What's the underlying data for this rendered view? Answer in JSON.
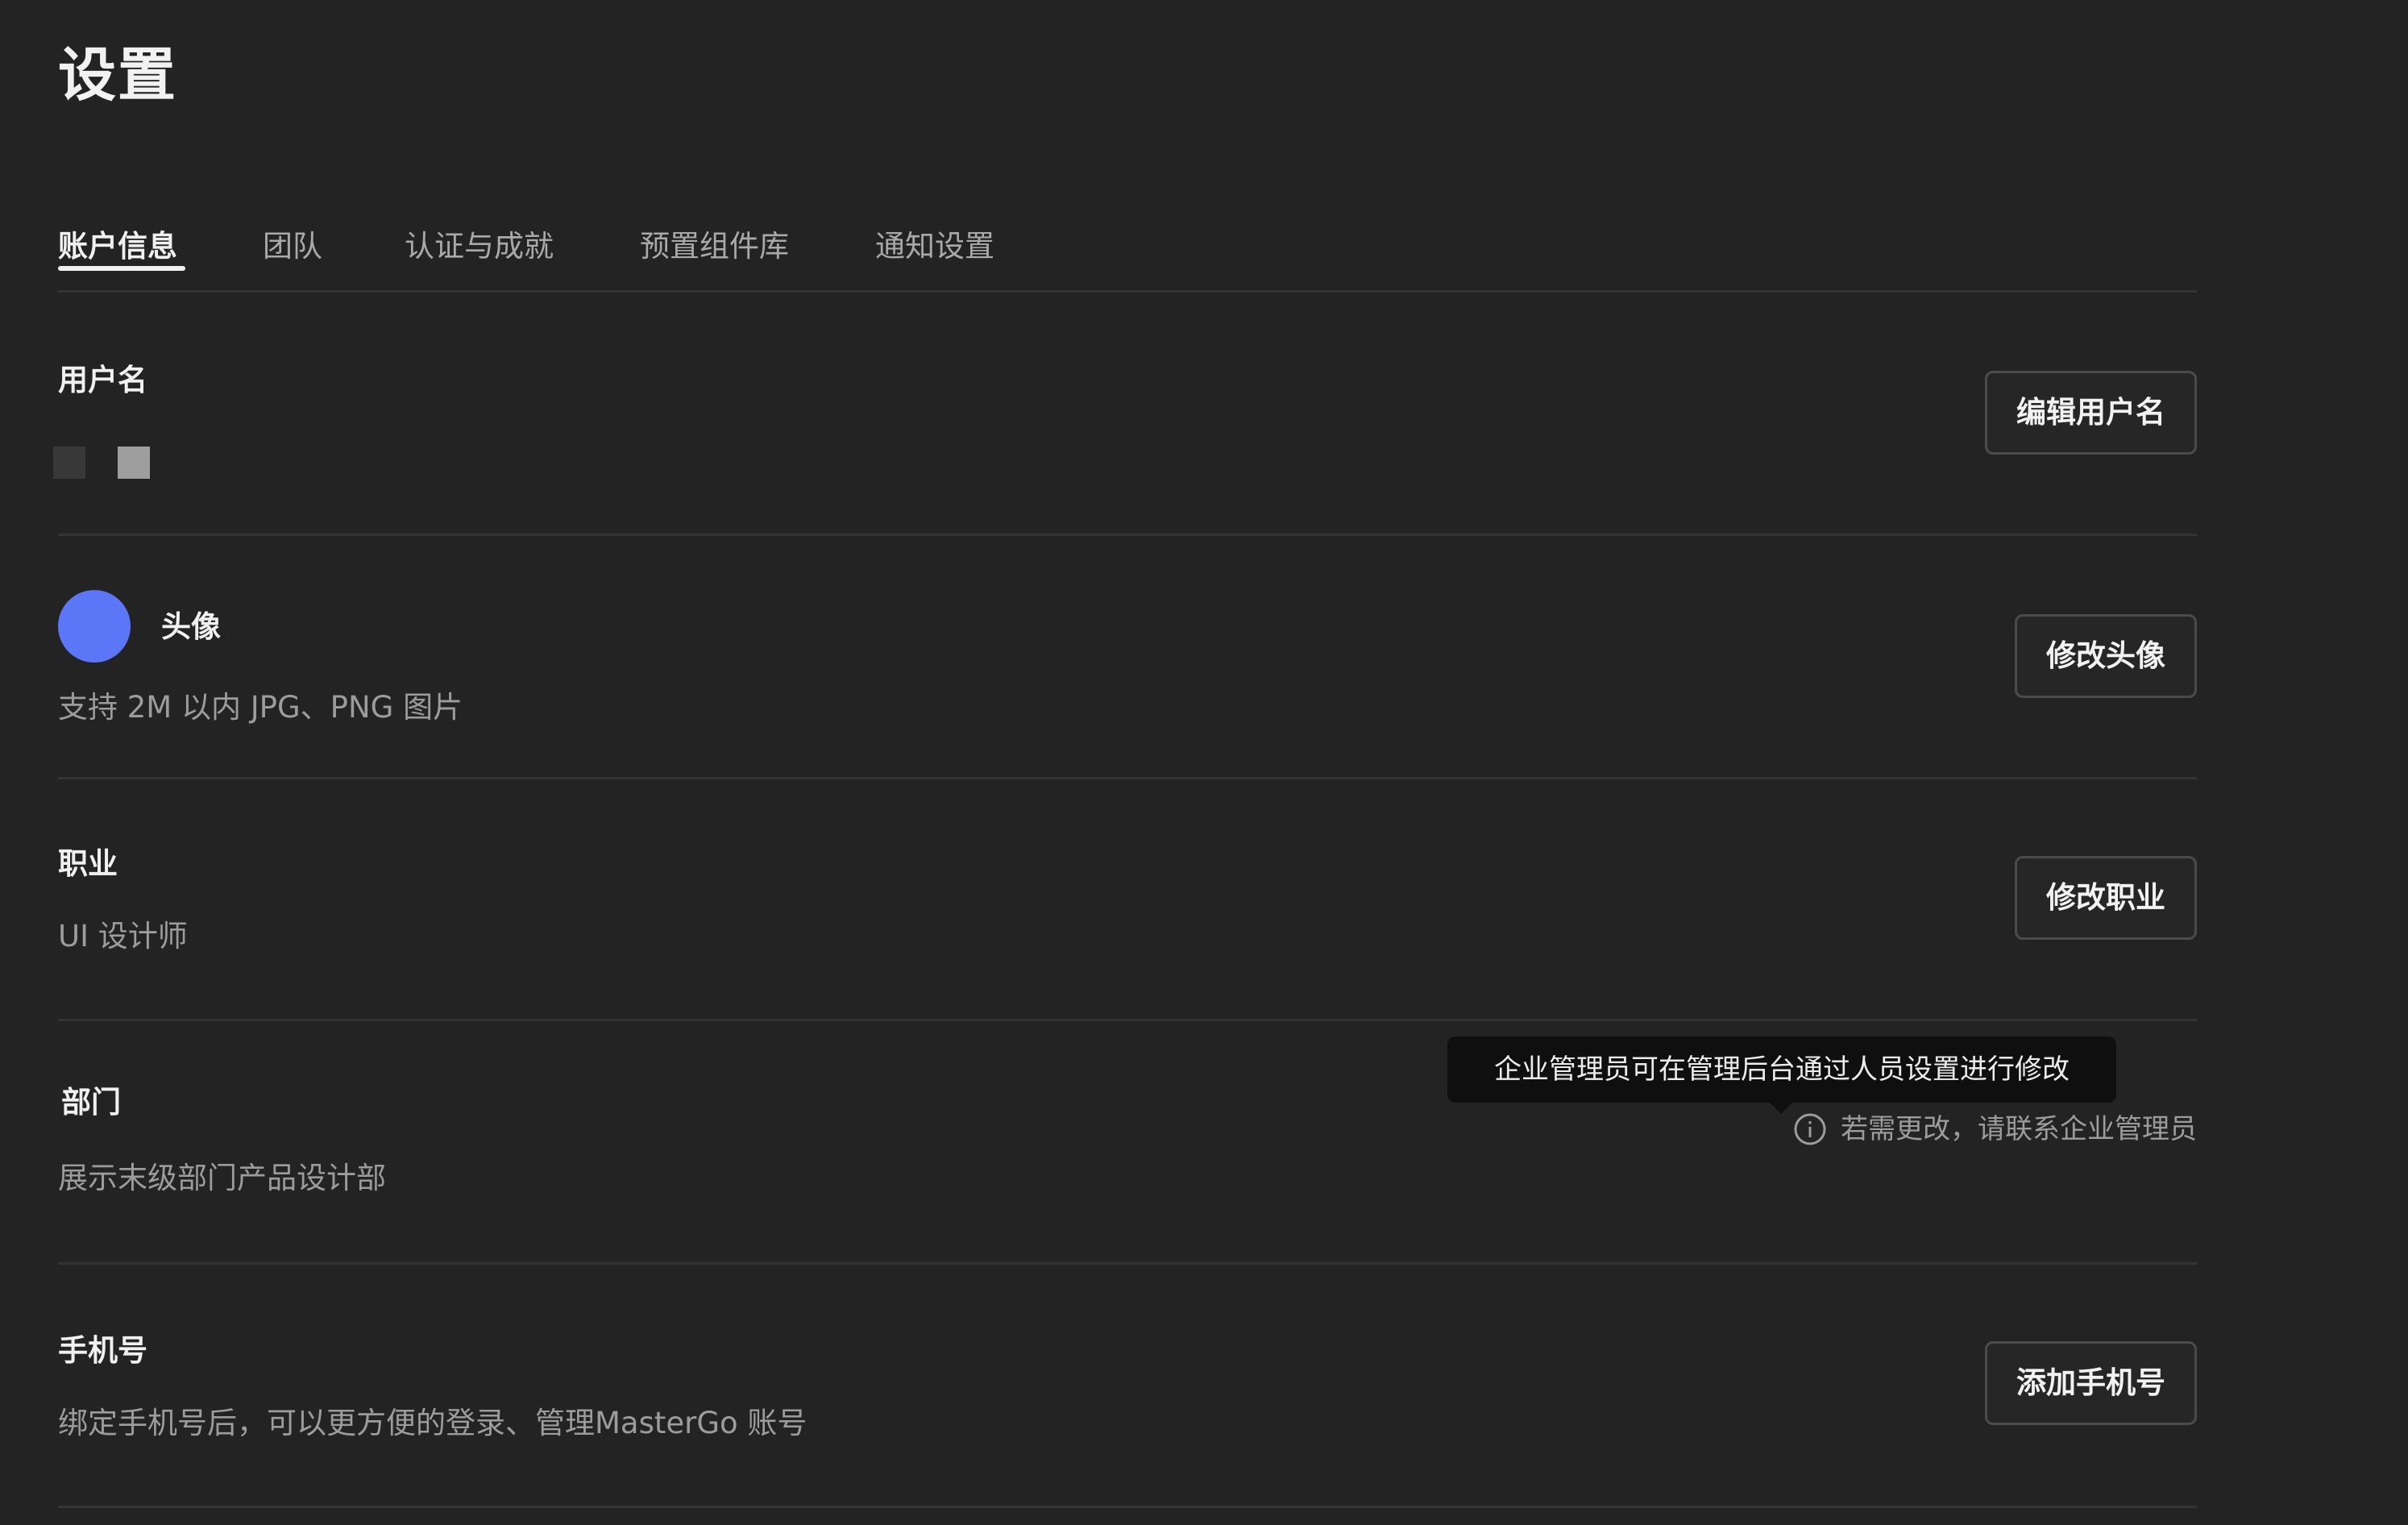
{
  "page_title": "设置",
  "tabs": [
    {
      "label": "账户信息",
      "active": true
    },
    {
      "label": "团队",
      "active": false
    },
    {
      "label": "认证与成就",
      "active": false
    },
    {
      "label": "预置组件库",
      "active": false
    },
    {
      "label": "通知设置",
      "active": false
    }
  ],
  "username": {
    "label": "用户名",
    "button": "编辑用户名"
  },
  "avatar": {
    "label": "头像",
    "hint": "支持 2M 以内 JPG、PNG 图片",
    "button": "修改头像",
    "color": "#5b76f6"
  },
  "profession": {
    "label": "职业",
    "value": "UI 设计师",
    "button": "修改职业"
  },
  "department": {
    "label": "部门",
    "value": "展示末级部门产品设计部",
    "tooltip": "企业管理员可在管理后台通过人员设置进行修改",
    "hint": "若需更改，请联系企业管理员",
    "icon": "info-icon"
  },
  "phone": {
    "label": "手机号",
    "hint": "绑定手机号后，可以更方便的登录、管理MasterGo 账号",
    "button": "添加手机号"
  }
}
